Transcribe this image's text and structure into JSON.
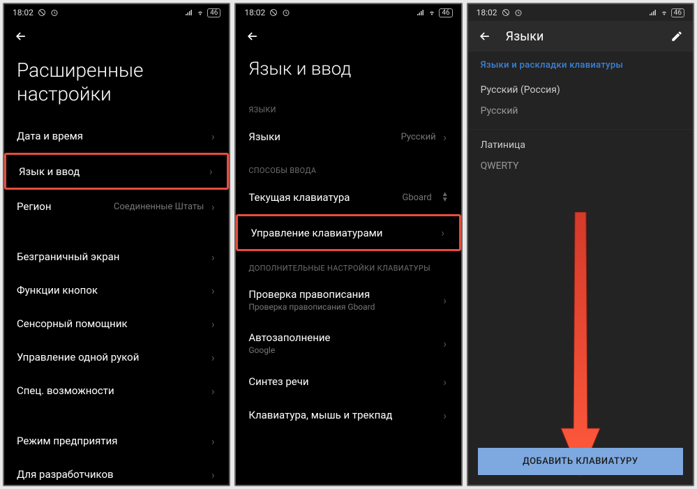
{
  "status": {
    "time": "18:02",
    "battery": "46"
  },
  "screen1": {
    "title": "Расширенные настройки",
    "items": {
      "datetime": "Дата и время",
      "language": "Язык и ввод",
      "region": "Регион",
      "region_value": "Соединенные Штаты",
      "fullscreen": "Безграничный экран",
      "buttons": "Функции кнопок",
      "assistant": "Сенсорный помощник",
      "onehand": "Управление одной рукой",
      "accessibility": "Спец. возможности",
      "enterprise": "Режим предприятия",
      "developer": "Для разработчиков"
    }
  },
  "screen2": {
    "title": "Язык и ввод",
    "sections": {
      "languages": "ЯЗЫКИ",
      "input_methods": "СПОСОБЫ ВВОДА",
      "additional": "ДОПОЛНИТЕЛЬНЫЕ НАСТРОЙКИ КЛАВИАТУРЫ"
    },
    "items": {
      "languages": "Языки",
      "languages_value": "Русский",
      "current_keyboard": "Текущая клавиатура",
      "current_keyboard_value": "Gboard",
      "manage_keyboards": "Управление клавиатурами",
      "spellcheck": "Проверка правописания",
      "spellcheck_sub": "Проверка правописания Gboard",
      "autofill": "Автозаполнение",
      "autofill_sub": "Google",
      "tts": "Синтез речи",
      "pointer": "Клавиатура, мышь и трекпад"
    }
  },
  "screen3": {
    "title": "Языки",
    "section": "Языки и раскладки клавиатуры",
    "lang1": "Русский (Россия)",
    "lang1_sub": "Русский",
    "lang2": "Латиница",
    "lang2_sub": "QWERTY",
    "add_button": "ДОБАВИТЬ КЛАВИАТУРУ"
  }
}
